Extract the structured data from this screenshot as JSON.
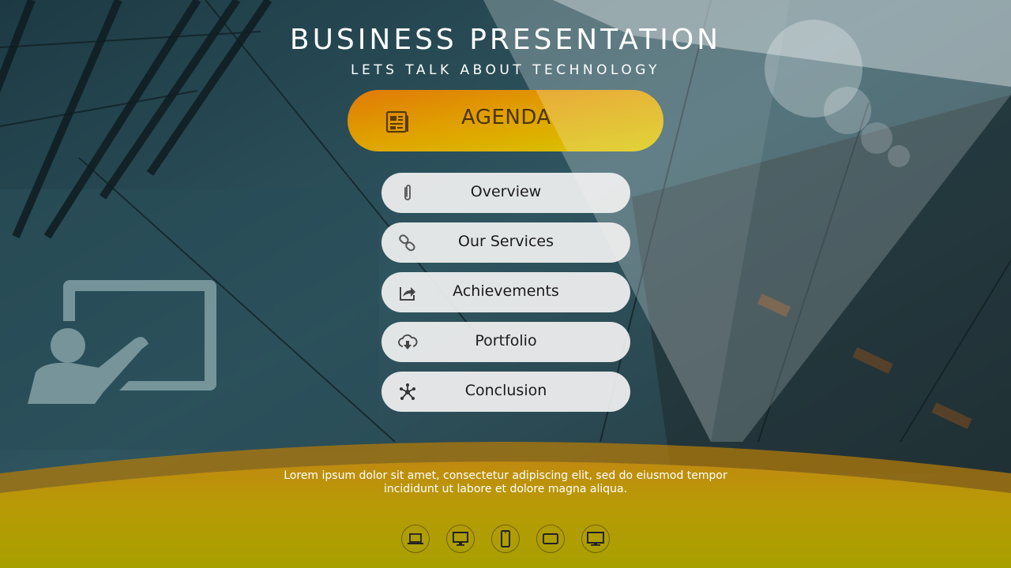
{
  "slide": {
    "title": "BUSINESS PRESENTATION",
    "subtitle": "LETS TALK ABOUT TECHNOLOGY",
    "accent_colors": {
      "orange": "#e07a08",
      "yellow": "#d8c800",
      "footer_yellow": "#b2a300"
    }
  },
  "agenda": {
    "icon": "newspaper-icon",
    "label": "AGENDA"
  },
  "menu": {
    "items": [
      {
        "label": "Overview",
        "icon": "paperclip-icon"
      },
      {
        "label": "Our Services",
        "icon": "link-icon"
      },
      {
        "label": "Achievements",
        "icon": "share-icon"
      },
      {
        "label": "Portfolio",
        "icon": "cloud-download-icon"
      },
      {
        "label": "Conclusion",
        "icon": "network-icon"
      }
    ]
  },
  "footer": {
    "text_line1": "Lorem ipsum dolor sit amet, consectetur adipiscing elit, sed do eiusmod tempor",
    "text_line2": "incididunt ut labore et dolore magna aliqua.",
    "devices": [
      "laptop-icon",
      "desktop-icon",
      "phone-icon",
      "tablet-icon",
      "monitor-icon"
    ]
  },
  "decorations": {
    "left_icon": "presenter-board-icon",
    "top_right": "bubbles"
  }
}
